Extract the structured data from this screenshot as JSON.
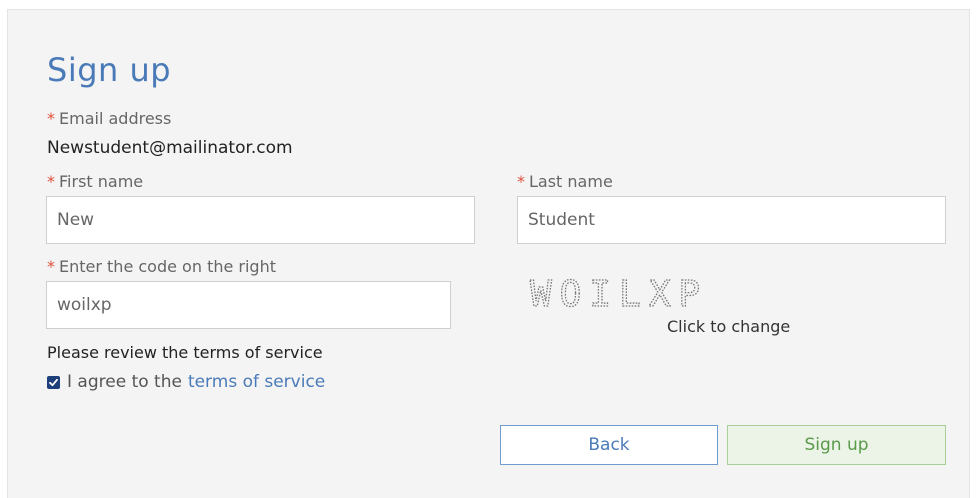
{
  "form": {
    "title": "Sign up",
    "required_marker": "*",
    "email": {
      "label": "Email address",
      "value": "Newstudent@mailinator.com"
    },
    "first_name": {
      "label": "First name",
      "value": "New"
    },
    "last_name": {
      "label": "Last name",
      "value": "Student"
    },
    "captcha": {
      "label": "Enter the code on the right",
      "value": "woilxp",
      "image_text": "WOILXP",
      "change_label": "Click to change"
    },
    "terms": {
      "heading": "Please review the terms of service",
      "agree_prefix": "I agree to the",
      "link_label": "terms of service",
      "checked": true
    },
    "buttons": {
      "back_label": "Back",
      "signup_label": "Sign up"
    }
  },
  "colors": {
    "accent": "#4a7ab8",
    "required": "#e0503c",
    "signup_button_bg": "#ecf4e8",
    "signup_button_text": "#5a9a4a",
    "panel_bg": "#f4f4f4"
  }
}
